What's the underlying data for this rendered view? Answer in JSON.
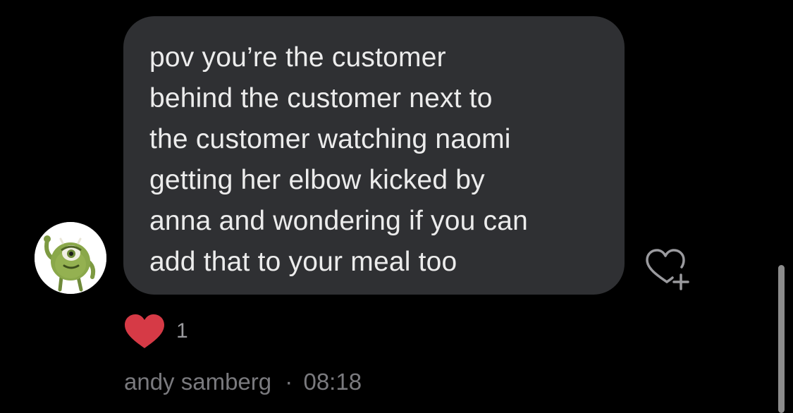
{
  "message": {
    "lines": [
      "pov you’re the customer",
      "behind the customer next to",
      "the customer watching naomi",
      "getting her elbow kicked by",
      "anna and wondering if you can",
      "add that to your meal too"
    ]
  },
  "reaction": {
    "icon": "heart-icon",
    "count": "1"
  },
  "sender": {
    "name": "andy samberg",
    "separator": "·",
    "time": "08:18"
  },
  "icons": {
    "add_reaction": "heart-plus-icon",
    "avatar": "avatar"
  },
  "colors": {
    "background": "#000000",
    "bubble": "#2f3033",
    "text": "#ececec",
    "heart": "#d63a46",
    "meta": "#7a7a7e"
  }
}
